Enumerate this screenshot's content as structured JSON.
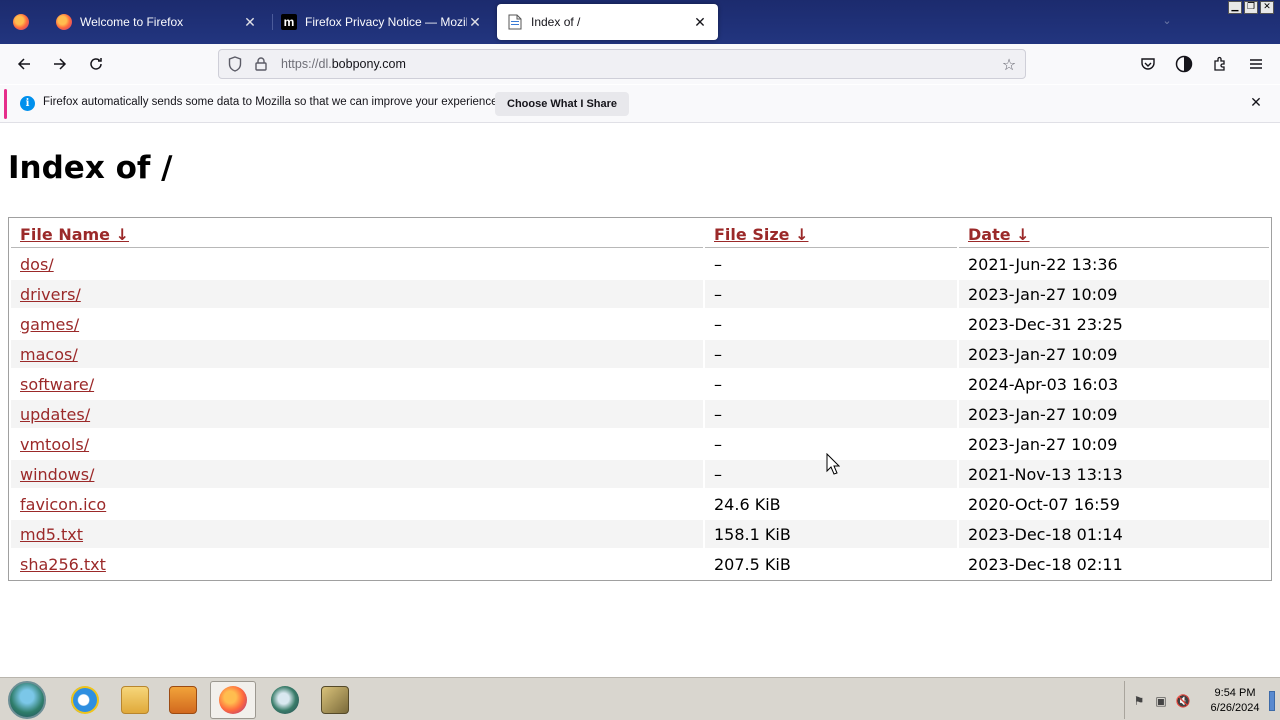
{
  "browser": {
    "tabs": [
      {
        "title": "Welcome to Firefox",
        "favicon": "firefox-icon",
        "active": false
      },
      {
        "title": "Firefox Privacy Notice — Mozilla",
        "favicon": "mozilla-m-icon",
        "active": false
      },
      {
        "title": "Index of /",
        "favicon": "page-icon",
        "active": true
      }
    ],
    "url": {
      "scheme": "https://dl.",
      "host": "bobpony.com"
    },
    "notification": {
      "text": "Firefox automatically sends some data to Mozilla so that we can improve your experience.",
      "button": "Choose What I Share"
    }
  },
  "page": {
    "heading": "Index of /",
    "columns": [
      "File Name  ↓",
      "File Size  ↓",
      "Date  ↓"
    ],
    "rows": [
      {
        "name": "dos/",
        "size": "–",
        "date": "2021-Jun-22 13:36"
      },
      {
        "name": "drivers/",
        "size": "–",
        "date": "2023-Jan-27 10:09"
      },
      {
        "name": "games/",
        "size": "–",
        "date": "2023-Dec-31 23:25"
      },
      {
        "name": "macos/",
        "size": "–",
        "date": "2023-Jan-27 10:09"
      },
      {
        "name": "software/",
        "size": "–",
        "date": "2024-Apr-03 16:03"
      },
      {
        "name": "updates/",
        "size": "–",
        "date": "2023-Jan-27 10:09"
      },
      {
        "name": "vmtools/",
        "size": "–",
        "date": "2023-Jan-27 10:09"
      },
      {
        "name": "windows/",
        "size": "–",
        "date": "2021-Nov-13 13:13"
      },
      {
        "name": "favicon.ico",
        "size": "24.6 KiB",
        "date": "2020-Oct-07 16:59"
      },
      {
        "name": "md5.txt",
        "size": "158.1 KiB",
        "date": "2023-Dec-18 01:14"
      },
      {
        "name": "sha256.txt",
        "size": "207.5 KiB",
        "date": "2023-Dec-18 02:11"
      }
    ]
  },
  "taskbar": {
    "time": "9:54 PM",
    "date": "6/26/2024"
  },
  "colors": {
    "link": "#9b2929",
    "tabstrip": "#1c2b6e",
    "notif_accent": "#e62e8b"
  }
}
